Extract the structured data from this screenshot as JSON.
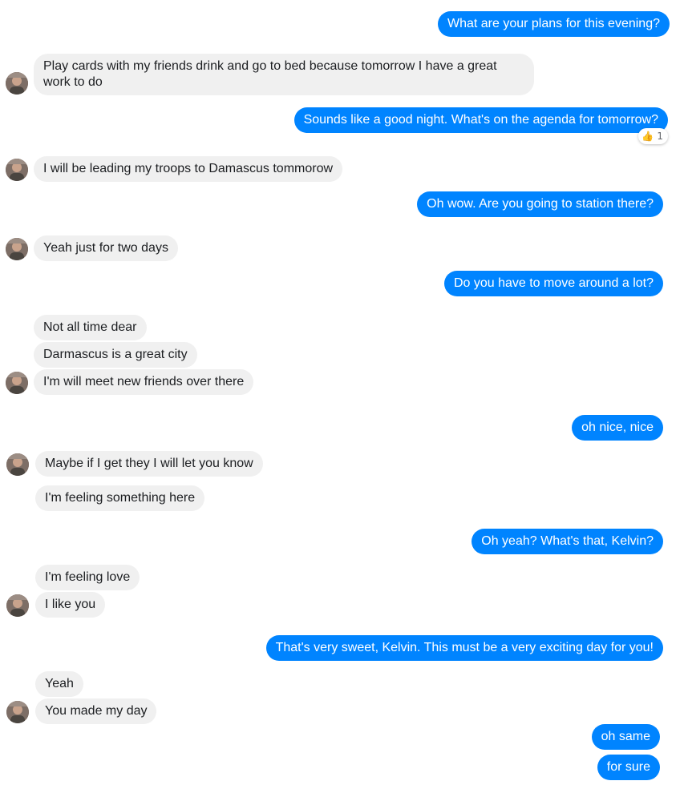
{
  "conversation": {
    "contact_name": "Kelvin",
    "messages": [
      {
        "from": "me",
        "text": "What are your plans for this evening?"
      },
      {
        "from": "them",
        "text": "Play cards with my friends drink and go to bed because tomorrow I have a great work to do"
      },
      {
        "from": "me",
        "text": "Sounds like a good night. What's on the agenda for tomorrow?",
        "reaction": {
          "emoji": "👍",
          "count": "1"
        }
      },
      {
        "from": "them",
        "text": "I will be leading my troops to Damascus tommorow"
      },
      {
        "from": "me",
        "text": "Oh wow. Are you going to station there?"
      },
      {
        "from": "them",
        "text": "Yeah just for two days"
      },
      {
        "from": "me",
        "text": "Do you have to move around a lot?"
      },
      {
        "from": "them",
        "text": "Not all time dear"
      },
      {
        "from": "them",
        "text": "Darmascus is a great city"
      },
      {
        "from": "them",
        "text": "I'm will meet new friends over there"
      },
      {
        "from": "me",
        "text": "oh nice, nice"
      },
      {
        "from": "them",
        "text": "Maybe if I get they I will let you know"
      },
      {
        "from": "them",
        "text": "I'm feeling something here"
      },
      {
        "from": "me",
        "text": "Oh yeah? What's that, Kelvin?"
      },
      {
        "from": "them",
        "text": "I'm feeling love"
      },
      {
        "from": "them",
        "text": "I like you"
      },
      {
        "from": "me",
        "text": "That's very sweet, Kelvin. This must be a very exciting day for you!"
      },
      {
        "from": "them",
        "text": "Yeah"
      },
      {
        "from": "them",
        "text": "You made my day"
      },
      {
        "from": "me",
        "text": "oh same"
      },
      {
        "from": "me",
        "text": "for sure"
      }
    ]
  },
  "colors": {
    "outgoing_bubble": "#0084ff",
    "incoming_bubble": "#f0f0f0",
    "outgoing_text": "#ffffff",
    "incoming_text": "#1c1e21"
  },
  "icons": {
    "avatar": "contact-avatar",
    "reaction": "thumbs-up-icon"
  }
}
